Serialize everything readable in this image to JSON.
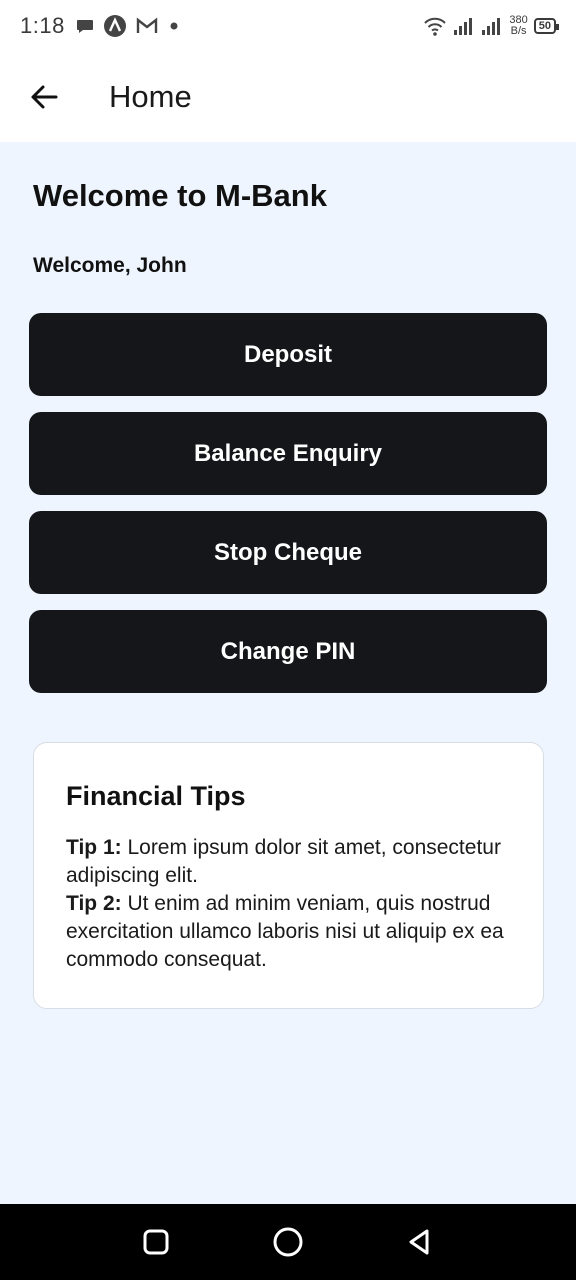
{
  "status_bar": {
    "time": "1:18",
    "net_speed_value": "380",
    "net_speed_unit": "B/s",
    "battery": "50",
    "icons": [
      "chat-bubble-icon",
      "app-a-icon",
      "gmail-icon",
      "dot-icon",
      "wifi-icon",
      "signal-icon",
      "signal-icon"
    ]
  },
  "app_bar": {
    "title": "Home",
    "back_icon": "arrow-left-icon"
  },
  "main": {
    "welcome_title": "Welcome to M-Bank",
    "welcome_user": "Welcome, John",
    "actions": [
      {
        "label": "Deposit"
      },
      {
        "label": "Balance Enquiry"
      },
      {
        "label": "Stop Cheque"
      },
      {
        "label": "Change PIN"
      }
    ]
  },
  "tips": {
    "title": "Financial Tips",
    "items": [
      {
        "label": "Tip 1:",
        "text": " Lorem ipsum dolor sit amet, consectetur adipiscing elit."
      },
      {
        "label": "Tip 2:",
        "text": " Ut enim ad minim veniam, quis nostrud exercitation ullamco laboris nisi ut aliquip ex ea commodo consequat."
      }
    ]
  },
  "nav_bar": {
    "icons": [
      "recents-square-icon",
      "home-circle-icon",
      "back-triangle-icon"
    ]
  },
  "colors": {
    "background": "#eef5ff",
    "button": "#14161a",
    "button_text": "#ffffff",
    "card": "#ffffff"
  }
}
